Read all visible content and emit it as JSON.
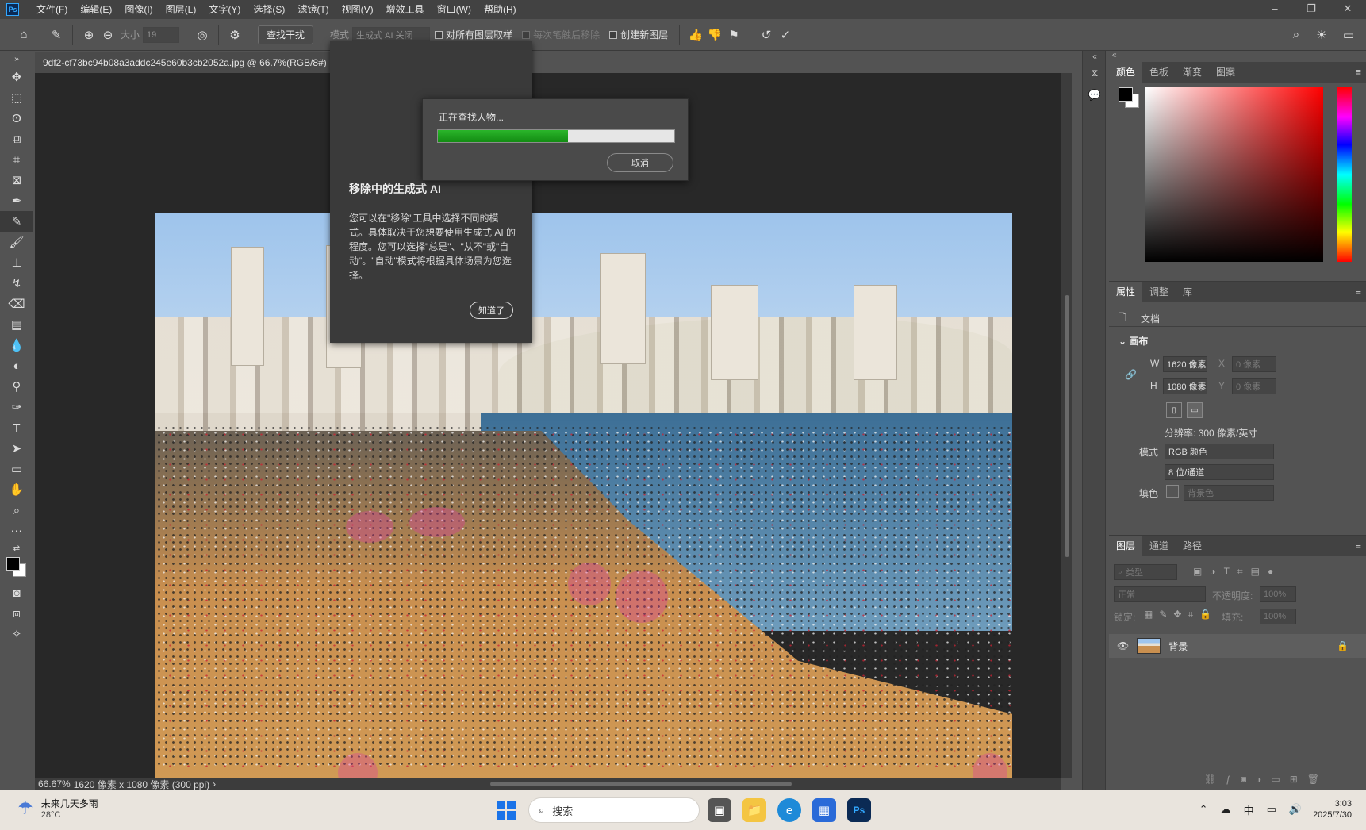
{
  "app": {
    "logo": "Ps"
  },
  "menu": [
    "文件(F)",
    "编辑(E)",
    "图像(I)",
    "图层(L)",
    "文字(Y)",
    "选择(S)",
    "滤镜(T)",
    "视图(V)",
    "增效工具",
    "窗口(W)",
    "帮助(H)"
  ],
  "options": {
    "size_label": "大小",
    "size_value": "19",
    "find_distractions": "查找干扰",
    "mode_label": "模式",
    "mode_value": "生成式 AI 关闭",
    "sample_all": "对所有图层取样",
    "remove_after": "每次笔触后移除",
    "new_layer": "创建新图层"
  },
  "document": {
    "tab_title": "9df2-cf73bc94b08a3addc245e60b3cb2052a.jpg @ 66.7%(RGB/8#)",
    "status_zoom": "66.67%",
    "status_info": "1620 像素 x 1080 像素 (300 ppi)"
  },
  "tooltip": {
    "title": "移除中的生成式 AI",
    "body": "您可以在\"移除\"工具中选择不同的模式。具体取决于您想要使用生成式 AI 的程度。您可以选择\"总是\"、\"从不\"或\"自动\"。\"自动\"模式将根据具体场景为您选择。",
    "ok": "知道了"
  },
  "dialog": {
    "text": "正在查找人物...",
    "progress": 0.55,
    "cancel": "取消"
  },
  "color_panel": {
    "tabs": [
      "颜色",
      "色板",
      "渐变",
      "图案"
    ]
  },
  "properties": {
    "tabs": [
      "属性",
      "调整",
      "库"
    ],
    "doc_label": "文档",
    "section": "画布",
    "w_label": "W",
    "w_value": "1620 像素",
    "h_label": "H",
    "h_value": "1080 像素",
    "x_label": "X",
    "x_value": "0 像素",
    "y_label": "Y",
    "y_value": "0 像素",
    "resolution": "分辨率: 300 像素/英寸",
    "mode_label": "模式",
    "mode_value": "RGB 颜色",
    "depth_value": "8 位/通道",
    "fill_label": "填色",
    "fill_value": "背景色"
  },
  "layers": {
    "tabs": [
      "图层",
      "通道",
      "路径"
    ],
    "filter_placeholder": "类型",
    "blend_mode": "正常",
    "opacity_label": "不透明度:",
    "opacity_value": "100%",
    "lock_label": "锁定:",
    "fill_label": "填充:",
    "fill_value": "100%",
    "layer_name": "背景"
  },
  "taskbar": {
    "weather_title": "未来几天多雨",
    "weather_temp": "28°C",
    "search_placeholder": "搜索",
    "ime": "中",
    "time": "3:03",
    "date": "2025/7/30"
  }
}
